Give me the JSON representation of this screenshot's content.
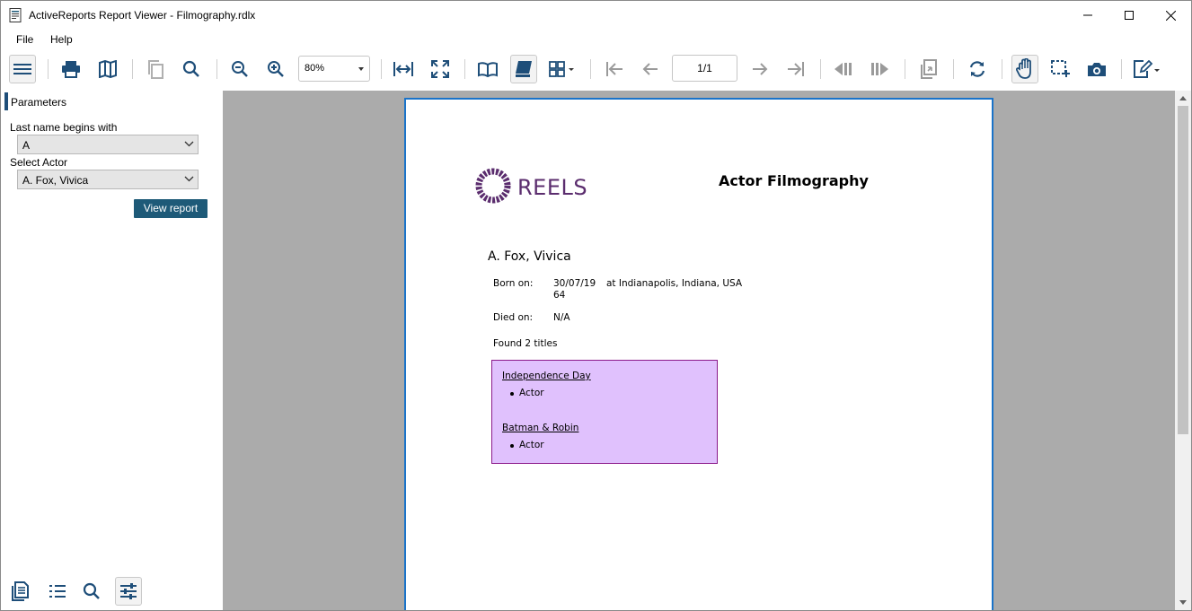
{
  "window": {
    "title": "ActiveReports Report Viewer - Filmography.rdlx"
  },
  "menu": {
    "file": "File",
    "help": "Help"
  },
  "toolbar": {
    "zoom_value": "80%",
    "page_indicator": "1/1"
  },
  "sidebar": {
    "panel_title": "Parameters",
    "param1_label": "Last name begins with",
    "param1_value": "A",
    "param2_label": "Select Actor",
    "param2_value": "A. Fox, Vivica",
    "view_report_label": "View report"
  },
  "report": {
    "logo_text": "REELS",
    "title": "Actor Filmography",
    "actor_name": "A. Fox, Vivica",
    "born_label": "Born on:",
    "born_date_line1": "30/07/19",
    "born_date_line2": "64",
    "born_place": "at Indianapolis, Indiana, USA",
    "died_label": "Died on:",
    "died_value": "N/A",
    "found_text": "Found 2 titles",
    "films": [
      {
        "title": "Independence Day",
        "role": "Actor"
      },
      {
        "title": "Batman & Robin",
        "role": "Actor"
      }
    ]
  },
  "colors": {
    "accent": "#1e5a78",
    "page_border": "#1a73c9",
    "titles_box_fill": "#e0c1fd",
    "titles_box_border": "#8b1a8b",
    "logo": "#5b2d6e",
    "viewer_bg": "#ababab"
  }
}
